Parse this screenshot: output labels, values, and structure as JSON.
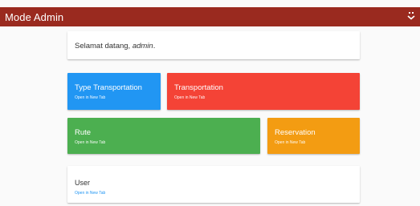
{
  "topbar": {
    "title": "Mode Admin",
    "menu_icon": "expand-icon"
  },
  "welcome": {
    "prefix": "Selamat datang, ",
    "user": "admin",
    "suffix": "."
  },
  "tiles": [
    {
      "label": "Type Transportation",
      "link": "Open in New Tab",
      "color": "#2196f3"
    },
    {
      "label": "Transportation",
      "link": "Open in New Tab",
      "color": "#f44336"
    },
    {
      "label": "Rute",
      "link": "Open in New Tab",
      "color": "#4caf50"
    },
    {
      "label": "Reservation",
      "link": "Open in New Tab",
      "color": "#f39c12"
    }
  ],
  "user_tile": {
    "label": "User",
    "link": "Open in New Tab"
  },
  "colors": {
    "topbar": "#9a2a1f",
    "link": "#2196f3"
  }
}
